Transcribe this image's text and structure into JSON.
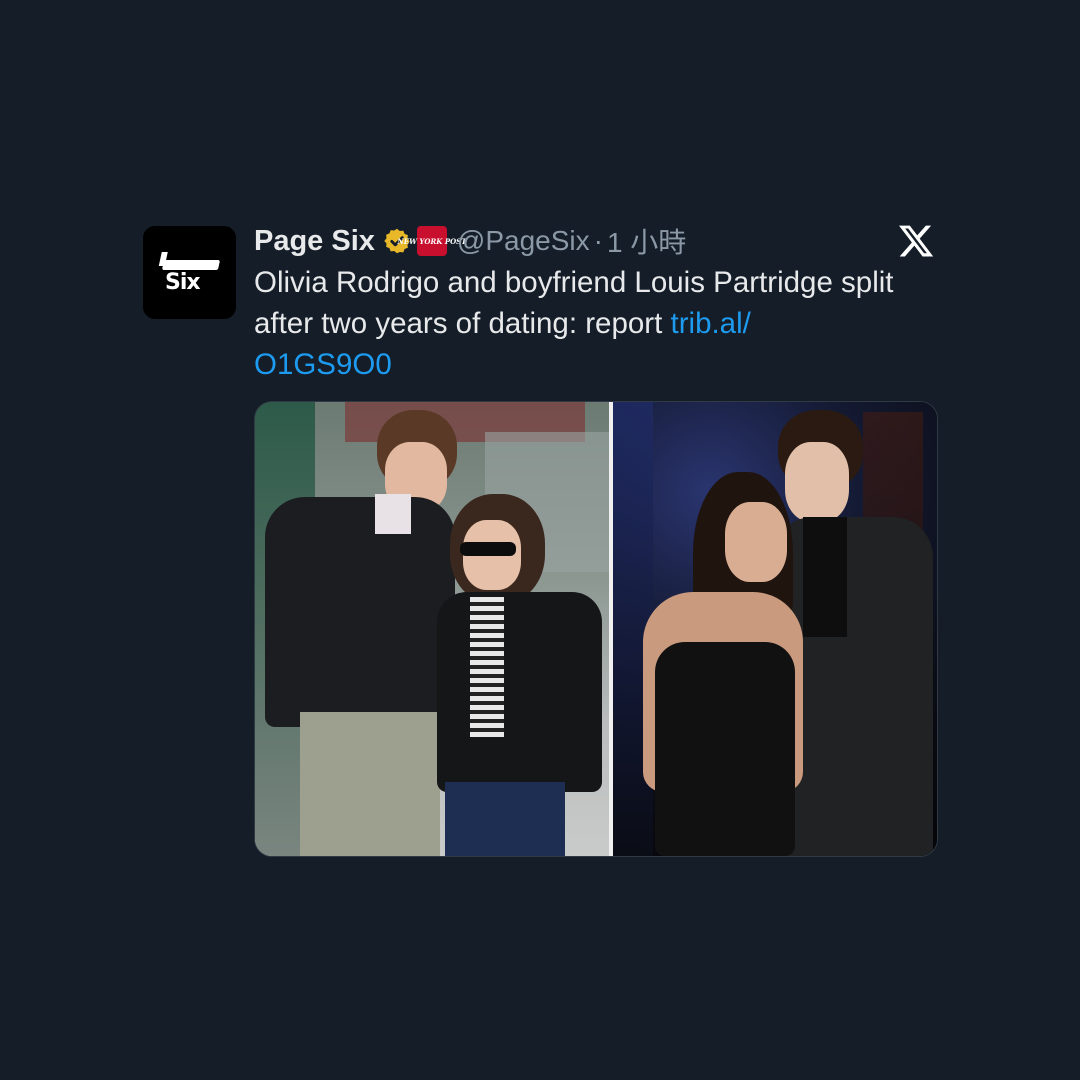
{
  "tweet": {
    "display_name": "Page Six",
    "affiliate_badge_text": "NEW YORK POST",
    "handle": "@PageSix",
    "separator": "·",
    "timestamp": "1 小時",
    "text": "Olivia Rodrigo and boyfriend Louis Partridge split after two years of dating: report ",
    "link": "trib.al/ O1GS9O0",
    "avatar_text": "Six"
  },
  "media": {
    "images": [
      {
        "label": "couple-walking-street-photo"
      },
      {
        "label": "couple-at-event-photo"
      }
    ]
  },
  "colors": {
    "background": "#141d28",
    "verified_gold": "#e8b829",
    "link_blue": "#1d9bf0",
    "nyp_red": "#c8102e"
  }
}
